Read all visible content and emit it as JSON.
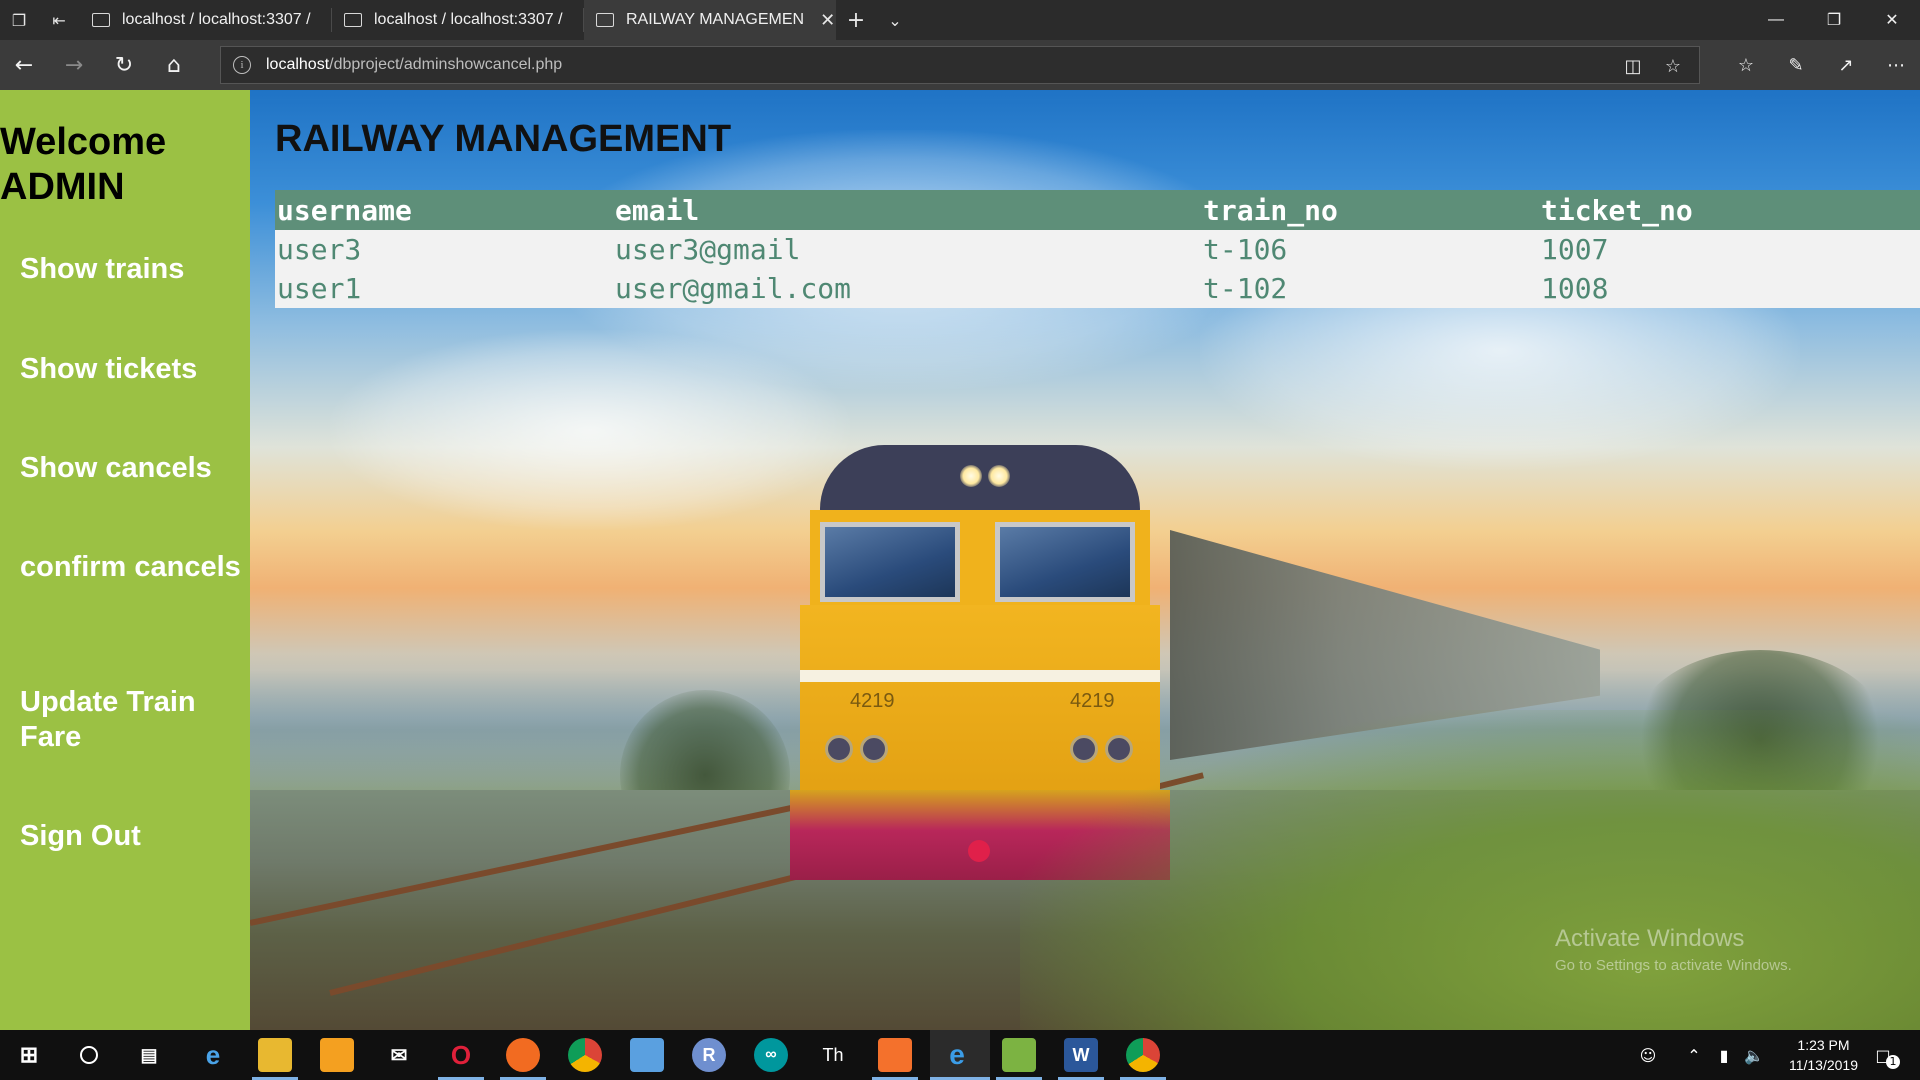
{
  "browser": {
    "tabs": [
      {
        "title": "localhost / localhost:3307 /",
        "active": false
      },
      {
        "title": "localhost / localhost:3307 /",
        "active": false
      },
      {
        "title": "RAILWAY MANAGEMEN",
        "active": true
      }
    ],
    "address": {
      "host": "localhost",
      "path": "/dbproject/adminshowcancel.php"
    }
  },
  "sidebar": {
    "welcome": "Welcome ADMIN",
    "items": [
      {
        "label": "Show trains"
      },
      {
        "label": "Show tickets"
      },
      {
        "label": "Show cancels"
      },
      {
        "label": "confirm cancels"
      },
      {
        "label": "Update Train Fare"
      },
      {
        "label": "Sign Out"
      }
    ]
  },
  "main": {
    "title": "RAILWAY MANAGEMENT",
    "table": {
      "headers": [
        "username",
        "email",
        "train_no",
        "ticket_no"
      ],
      "rows": [
        [
          "user3",
          "user3@gmail",
          "t-106",
          "1007"
        ],
        [
          "user1",
          "user@gmail.com",
          "t-102",
          "1008"
        ]
      ]
    },
    "watermark": {
      "line1": "Activate Windows",
      "line2": "Go to Settings to activate Windows."
    }
  },
  "loco_number": "4219",
  "taskbar": {
    "time": "1:23 PM",
    "date": "11/13/2019",
    "notification_count": "1",
    "icons": [
      "windows-start-icon",
      "search-circle-icon",
      "task-view-icon",
      "internet-explorer-icon",
      "file-explorer-icon",
      "app-icon",
      "mail-icon",
      "opera-icon",
      "firefox-icon",
      "chrome-icon",
      "box-icon",
      "r-icon",
      "arduino-icon",
      "th-icon",
      "xampp-icon",
      "edge-icon",
      "chart-editor-icon",
      "word-icon",
      "chrome-icon"
    ]
  },
  "colors": {
    "sidebar": "#9bc144",
    "table_header": "#5e8f79",
    "table_text": "#4f8873",
    "table_row": "#f2f2f2"
  }
}
